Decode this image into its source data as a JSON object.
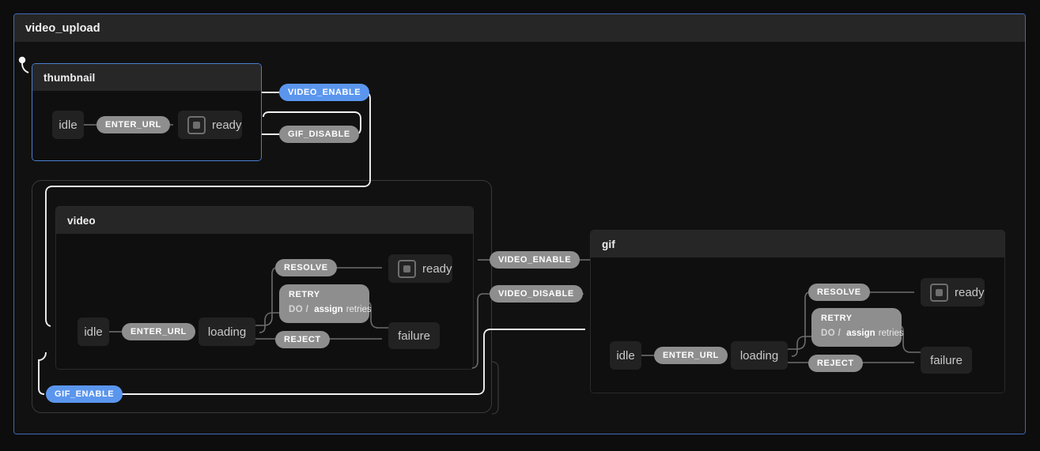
{
  "machine": {
    "title": "video_upload",
    "accent_color": "#4a7fd4",
    "background": "#111111"
  },
  "colors": {
    "event_badge": "#8e8e8e",
    "event_badge_active": "#5b96ee",
    "node_fill": "#222222",
    "node_text": "#c9c9c9",
    "edge_internal": "#6d6d6d",
    "edge_external": "#f2f2f2",
    "panel_header": "#262626"
  },
  "regions": [
    {
      "id": "thumbnail",
      "title": "thumbnail",
      "active": true,
      "states": [
        {
          "id": "thumbnail-idle",
          "label": "idle",
          "type": "atomic"
        },
        {
          "id": "thumbnail-ready",
          "label": "ready",
          "type": "final"
        }
      ],
      "transitions": [
        {
          "event": "ENTER_URL",
          "from": "idle",
          "to": "ready"
        }
      ]
    },
    {
      "id": "video",
      "title": "video",
      "active": false,
      "states": [
        {
          "id": "video-idle",
          "label": "idle",
          "type": "atomic"
        },
        {
          "id": "video-loading",
          "label": "loading",
          "type": "atomic"
        },
        {
          "id": "video-ready",
          "label": "ready",
          "type": "final"
        },
        {
          "id": "video-failure",
          "label": "failure",
          "type": "atomic"
        }
      ],
      "transitions": [
        {
          "event": "ENTER_URL",
          "from": "idle",
          "to": "loading"
        },
        {
          "event": "RESOLVE",
          "from": "loading",
          "to": "ready"
        },
        {
          "event": "REJECT",
          "from": "loading",
          "to": "failure"
        },
        {
          "event": "RETRY",
          "from": "failure",
          "to": "loading",
          "action": {
            "kind": "DO /",
            "fn": "assign",
            "arg": "retries"
          }
        }
      ]
    },
    {
      "id": "gif",
      "title": "gif",
      "active": false,
      "states": [
        {
          "id": "gif-idle",
          "label": "idle",
          "type": "atomic"
        },
        {
          "id": "gif-loading",
          "label": "loading",
          "type": "atomic"
        },
        {
          "id": "gif-ready",
          "label": "ready",
          "type": "final"
        },
        {
          "id": "gif-failure",
          "label": "failure",
          "type": "atomic"
        }
      ],
      "transitions": [
        {
          "event": "ENTER_URL",
          "from": "idle",
          "to": "loading"
        },
        {
          "event": "RESOLVE",
          "from": "loading",
          "to": "ready"
        },
        {
          "event": "REJECT",
          "from": "loading",
          "to": "failure"
        },
        {
          "event": "RETRY",
          "from": "failure",
          "to": "loading",
          "action": {
            "kind": "DO /",
            "fn": "assign",
            "arg": "retries"
          }
        }
      ]
    }
  ],
  "cross_transitions": [
    {
      "event": "VIDEO_ENABLE",
      "active": true,
      "from": "thumbnail",
      "to": "video"
    },
    {
      "event": "GIF_DISABLE",
      "active": false,
      "from": "gif",
      "to": "thumbnail"
    },
    {
      "event": "VIDEO_ENABLE",
      "active": false,
      "from": "gif",
      "to": "video"
    },
    {
      "event": "VIDEO_DISABLE",
      "active": false,
      "from": "video",
      "to": "gif"
    },
    {
      "event": "GIF_ENABLE",
      "active": true,
      "from": "video",
      "to": "gif"
    }
  ],
  "labels": {
    "thumbnail_title": "thumbnail",
    "video_title": "video",
    "gif_title": "gif",
    "idle": "idle",
    "ready": "ready",
    "loading": "loading",
    "failure": "failure",
    "enter_url": "ENTER_URL",
    "resolve": "RESOLVE",
    "reject": "REJECT",
    "retry": "RETRY",
    "do_kw": "DO /",
    "assign_fn": "assign",
    "assign_arg": "retries",
    "video_enable": "VIDEO_ENABLE",
    "video_disable": "VIDEO_DISABLE",
    "gif_enable": "GIF_ENABLE",
    "gif_disable": "GIF_DISABLE"
  }
}
